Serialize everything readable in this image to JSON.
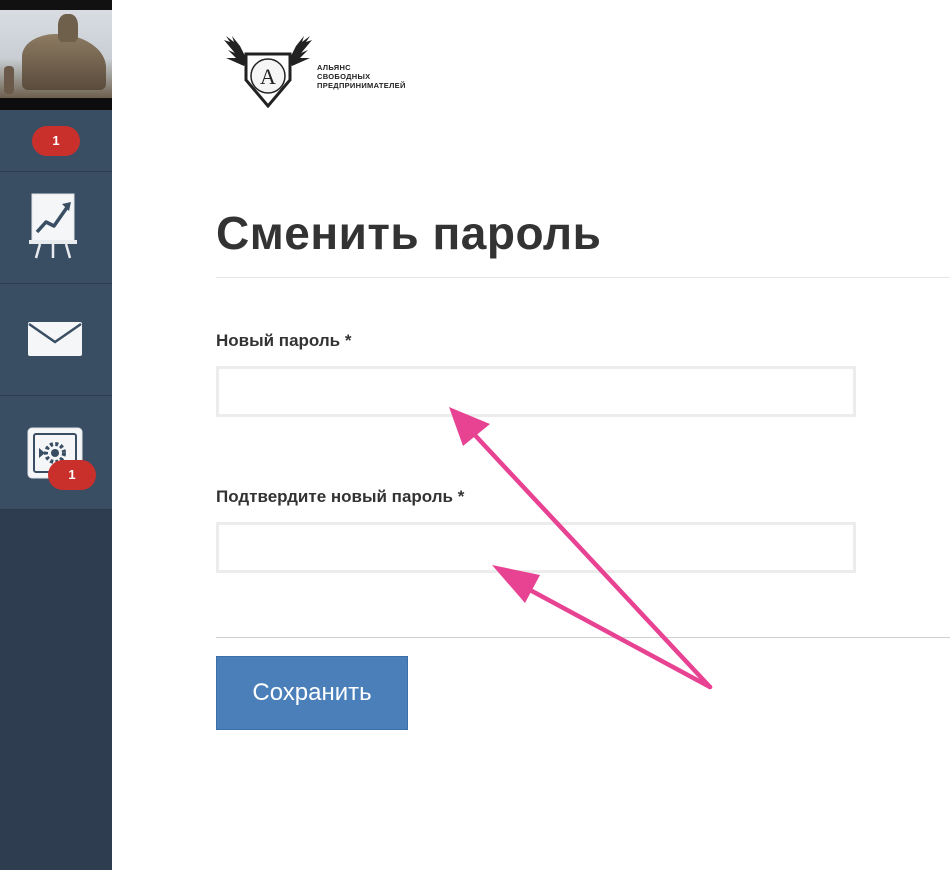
{
  "sidebar": {
    "notifications_badge": "1",
    "settings_badge": "1",
    "items": [
      {
        "icon": "chart-presentation-icon"
      },
      {
        "icon": "mail-icon"
      },
      {
        "icon": "settings-gear-icon"
      }
    ],
    "colors": {
      "background": "#2e3d4f",
      "item_background": "#3a4e63",
      "badge": "#c9302c"
    }
  },
  "logo": {
    "emblem_letter": "A",
    "lines": [
      "АЛЬЯНС",
      "СВОБОДНЫХ",
      "ПРЕДПРИНИМАТЕЛЕЙ"
    ]
  },
  "page": {
    "title": "Сменить пароль"
  },
  "form": {
    "new_password_label": "Новый пароль *",
    "new_password_value": "",
    "confirm_password_label": "Подтвердите новый пароль *",
    "confirm_password_value": "",
    "save_label": "Сохранить"
  },
  "colors": {
    "accent_button": "#4a7fba",
    "annotation_arrow": "#e84393"
  }
}
